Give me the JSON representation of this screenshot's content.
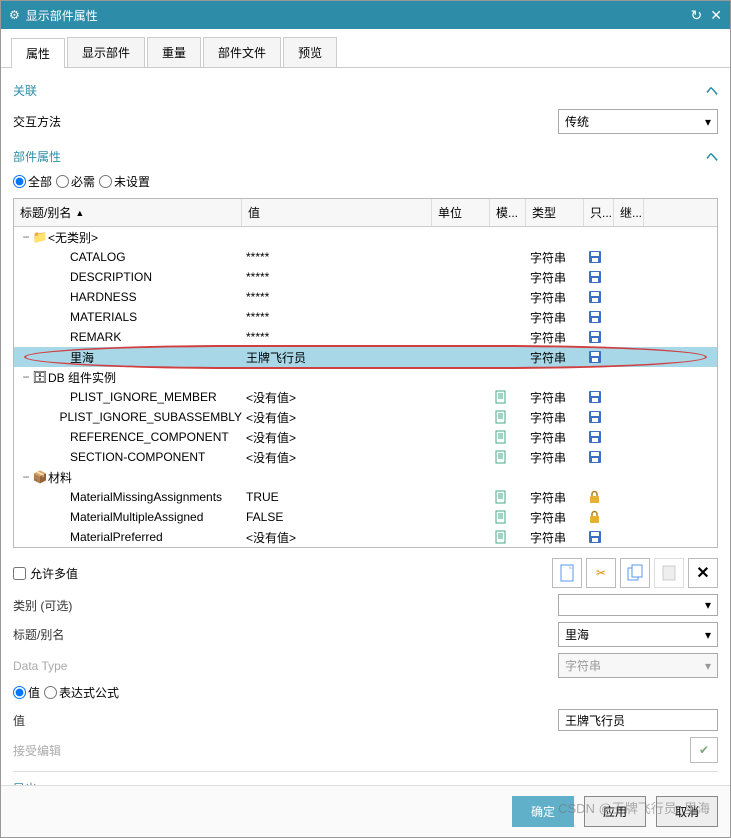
{
  "window": {
    "title": "显示部件属性"
  },
  "tabs": [
    "属性",
    "显示部件",
    "重量",
    "部件文件",
    "预览"
  ],
  "section_assoc": {
    "title": "关联"
  },
  "interaction": {
    "label": "交互方法",
    "value": "传统"
  },
  "section_attr": {
    "title": "部件属性"
  },
  "filter": {
    "all": "全部",
    "required": "必需",
    "unset": "未设置"
  },
  "columns": {
    "title": "标题/别名",
    "value": "值",
    "unit": "单位",
    "mod": "模...",
    "type": "类型",
    "only": "只...",
    "inh": "继..."
  },
  "groups": [
    {
      "name": "<无类别>",
      "icon": "folder",
      "expanded": true,
      "rows": [
        {
          "title": "CATALOG",
          "value": "*****",
          "type": "字符串",
          "save": true
        },
        {
          "title": "DESCRIPTION",
          "value": "*****",
          "type": "字符串",
          "save": true
        },
        {
          "title": "HARDNESS",
          "value": "*****",
          "type": "字符串",
          "save": true
        },
        {
          "title": "MATERIALS",
          "value": "*****",
          "type": "字符串",
          "save": true
        },
        {
          "title": "REMARK",
          "value": "*****",
          "type": "字符串",
          "save": true
        },
        {
          "title": "里海",
          "value": "王牌飞行员",
          "type": "字符串",
          "save": true,
          "selected": true
        }
      ]
    },
    {
      "name": "DB 组件实例",
      "icon": "db",
      "expanded": true,
      "rows": [
        {
          "title": "PLIST_IGNORE_MEMBER",
          "value": "<没有值>",
          "type": "字符串",
          "mod": true,
          "save": true
        },
        {
          "title": "PLIST_IGNORE_SUBASSEMBLY",
          "value": "<没有值>",
          "type": "字符串",
          "mod": true,
          "save": true
        },
        {
          "title": "REFERENCE_COMPONENT",
          "value": "<没有值>",
          "type": "字符串",
          "mod": true,
          "save": true
        },
        {
          "title": "SECTION-COMPONENT",
          "value": "<没有值>",
          "type": "字符串",
          "mod": true,
          "save": true
        }
      ]
    },
    {
      "name": "材料",
      "icon": "mat",
      "expanded": true,
      "rows": [
        {
          "title": "MaterialMissingAssignments",
          "value": "TRUE",
          "type": "字符串",
          "mod": true,
          "lock": true
        },
        {
          "title": "MaterialMultipleAssigned",
          "value": "FALSE",
          "type": "字符串",
          "mod": true,
          "lock": true
        },
        {
          "title": "MaterialPreferred",
          "value": "<没有值>",
          "type": "字符串",
          "mod": true,
          "save": true
        }
      ]
    }
  ],
  "allow_multi": {
    "label": "允许多值"
  },
  "category": {
    "label": "类别 (可选)",
    "value": ""
  },
  "title_alias": {
    "label": "标题/别名",
    "value": "里海"
  },
  "data_type": {
    "label": "Data Type",
    "value": "字符串"
  },
  "value_mode": {
    "value": "值",
    "expr": "表达式公式"
  },
  "value_field": {
    "label": "值",
    "value": "王牌飞行员"
  },
  "accept_edit": {
    "label": "接受编辑"
  },
  "export": {
    "label": "导出"
  },
  "buttons": {
    "ok": "确定",
    "apply": "应用",
    "cancel": "取消"
  },
  "watermark": "CSDN @王牌飞行员_里海"
}
